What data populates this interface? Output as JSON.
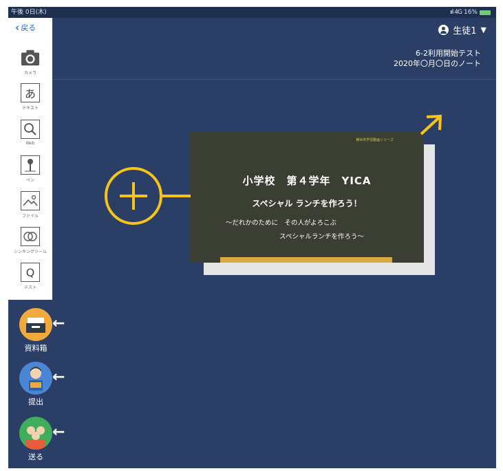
{
  "status_bar": {
    "time": "午後 0日(木)",
    "signal": "ııl 4G",
    "battery": "16%"
  },
  "toolbar": {
    "back_label": "戻る",
    "tools": [
      {
        "label": "カメラ",
        "icon": "camera-icon"
      },
      {
        "label": "テキスト",
        "glyph": "あ",
        "icon": "text-icon"
      },
      {
        "label": "Web",
        "icon": "web-search-icon"
      },
      {
        "label": "ペン",
        "icon": "pen-icon"
      },
      {
        "label": "ファイル",
        "icon": "file-icon"
      },
      {
        "label": "シンキングツール",
        "icon": "thinking-tool-icon"
      },
      {
        "label": "テスト",
        "glyph": "Q",
        "icon": "test-icon"
      }
    ]
  },
  "header": {
    "user_name": "生徒1",
    "note_title_1": "6-2利用開始テスト",
    "note_title_2": "2020年〇月〇日のノート"
  },
  "card": {
    "series": "横浜市学習動画シリーズ",
    "title": "小学校　第４学年　YICA",
    "subtitle": "スペシャル ランチを作ろう！",
    "line1": "～だれかのために　その人がよろこぶ",
    "line2": "スペシャルランチを作ろう～"
  },
  "actions": [
    {
      "label": "資料箱",
      "icon": "document-box-icon",
      "color": "#f2a93b"
    },
    {
      "label": "提出",
      "icon": "student-submit-icon",
      "color": "#4a86d6"
    },
    {
      "label": "送る",
      "icon": "send-people-icon",
      "color": "#3fae5a"
    }
  ],
  "colors": {
    "background": "#2b3f66",
    "accent_yellow": "#f5c518",
    "link_blue": "#2d6fd6"
  }
}
